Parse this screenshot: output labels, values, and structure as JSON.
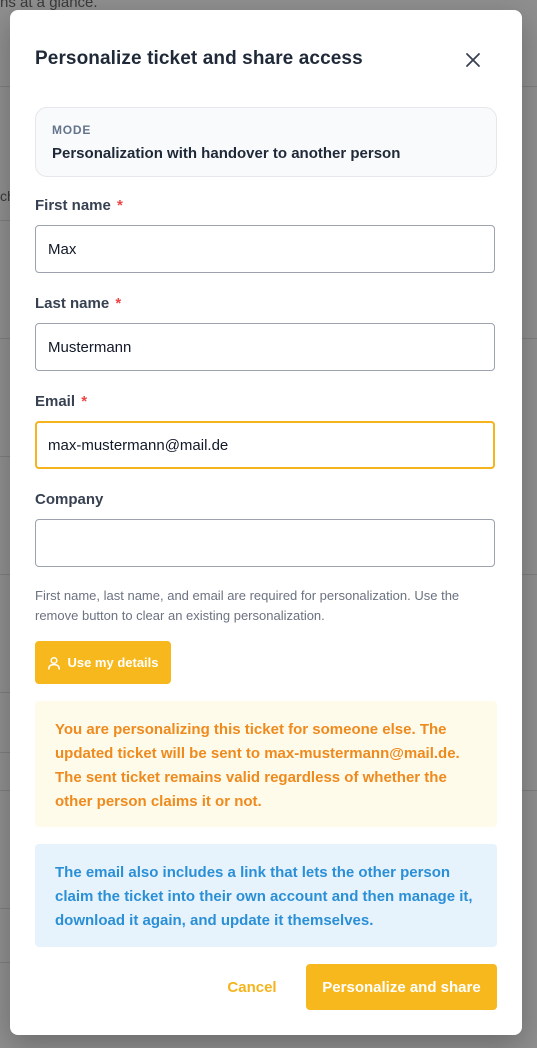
{
  "background": {
    "fragment_top": "ns at a glance.",
    "fragment_side": "ch"
  },
  "modal": {
    "title": "Personalize ticket and share access",
    "close_icon": "close-icon",
    "mode": {
      "label": "MODE",
      "value": "Personalization with handover to another person"
    },
    "fields": {
      "first_name": {
        "label": "First name",
        "required_marker": "*",
        "value": "Max"
      },
      "last_name": {
        "label": "Last name",
        "required_marker": "*",
        "value": "Mustermann"
      },
      "email": {
        "label": "Email",
        "required_marker": "*",
        "value": "max-mustermann@mail.de"
      },
      "company": {
        "label": "Company",
        "value": ""
      }
    },
    "helper_text": "First name, last name, and email are required for personalization. Use the remove button to clear an existing personalization.",
    "use_my_details": {
      "label": "Use my details",
      "icon": "user-icon"
    },
    "warning_message": "You are personalizing this ticket for someone else. The updated ticket will be sent to max-mustermann@mail.de. The sent ticket remains valid regardless of whether the other person claims it or not.",
    "info_message": "The email also includes a link that lets the other person claim the ticket into their own account and then manage it, download it again, and update it themselves.",
    "actions": {
      "cancel_label": "Cancel",
      "submit_label": "Personalize and share"
    }
  },
  "colors": {
    "accent": "#f6b81c",
    "required": "#ef4444",
    "warning_text": "#ee8a1e",
    "warning_bg": "#fffbea",
    "info_text": "#2b8fd6",
    "info_bg": "#e6f3fc"
  }
}
